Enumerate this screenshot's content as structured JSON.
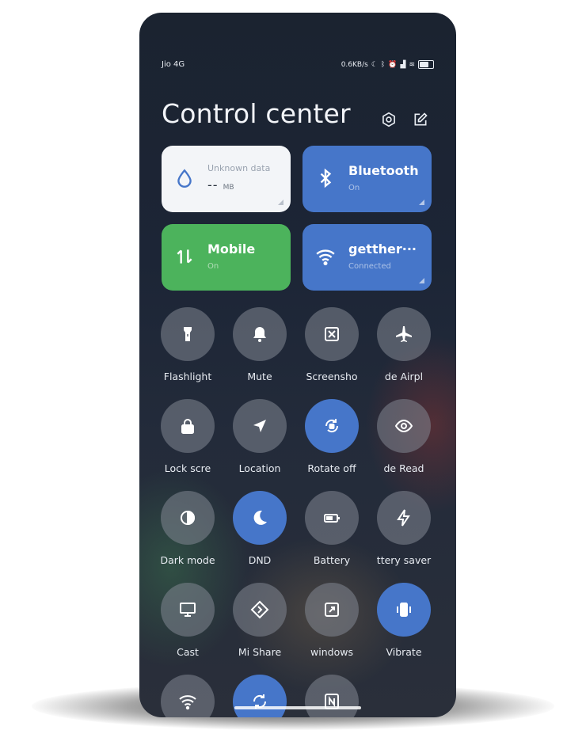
{
  "status_bar": {
    "carrier": "Jio 4G",
    "speed": "0.6KB/s",
    "icons": [
      "moon-icon",
      "bluetooth-icon",
      "alarm-icon",
      "signal-icon",
      "wifi-icon",
      "battery-icon"
    ]
  },
  "header": {
    "title": "Control center",
    "settings_icon": "gear-icon",
    "edit_icon": "edit-icon"
  },
  "tiles": {
    "data": {
      "title": "Unknown data",
      "value": "--",
      "unit": "MB",
      "icon": "drop-icon"
    },
    "bluetooth": {
      "title": "Bluetooth",
      "sub": "On",
      "icon": "bluetooth-icon"
    },
    "mobile": {
      "title": "Mobile",
      "sub": "On",
      "icon": "updown-arrows-icon"
    },
    "wifi": {
      "title": "getther···",
      "sub": "Connected",
      "icon": "wifi-icon"
    }
  },
  "toggles": [
    {
      "label": "Flashlight",
      "icon": "flashlight-icon",
      "on": false
    },
    {
      "label": "Mute",
      "icon": "bell-icon",
      "on": false
    },
    {
      "label": "Screensho",
      "icon": "scissors-icon",
      "on": false
    },
    {
      "label": "de   Airpl",
      "icon": "airplane-icon",
      "on": false
    },
    {
      "label": "Lock scre",
      "icon": "lock-icon",
      "on": false
    },
    {
      "label": "Location",
      "icon": "location-arrow-icon",
      "on": false
    },
    {
      "label": "Rotate off",
      "icon": "rotate-lock-icon",
      "on": true
    },
    {
      "label": "de   Read",
      "icon": "eye-icon",
      "on": false
    },
    {
      "label": "Dark mode",
      "icon": "dark-mode-icon",
      "on": false
    },
    {
      "label": "DND",
      "icon": "moon-icon",
      "on": true
    },
    {
      "label": "Battery",
      "icon": "battery-icon",
      "on": false
    },
    {
      "label": "ttery saver",
      "icon": "lightning-icon",
      "on": false
    },
    {
      "label": "Cast",
      "icon": "monitor-icon",
      "on": false
    },
    {
      "label": "Mi Share",
      "icon": "mi-share-icon",
      "on": false
    },
    {
      "label": "windows",
      "icon": "floating-window-icon",
      "on": false
    },
    {
      "label": "Vibrate",
      "icon": "vibrate-icon",
      "on": true
    },
    {
      "label": "",
      "icon": "wifi-icon",
      "on": false
    },
    {
      "label": "",
      "icon": "sync-icon",
      "on": true
    },
    {
      "label": "",
      "icon": "nfc-icon",
      "on": false
    }
  ],
  "colors": {
    "accent_blue": "#4676c9",
    "mobile_green": "#4cb35c",
    "toggle_off": "#82878f",
    "background": "#1c2536"
  }
}
